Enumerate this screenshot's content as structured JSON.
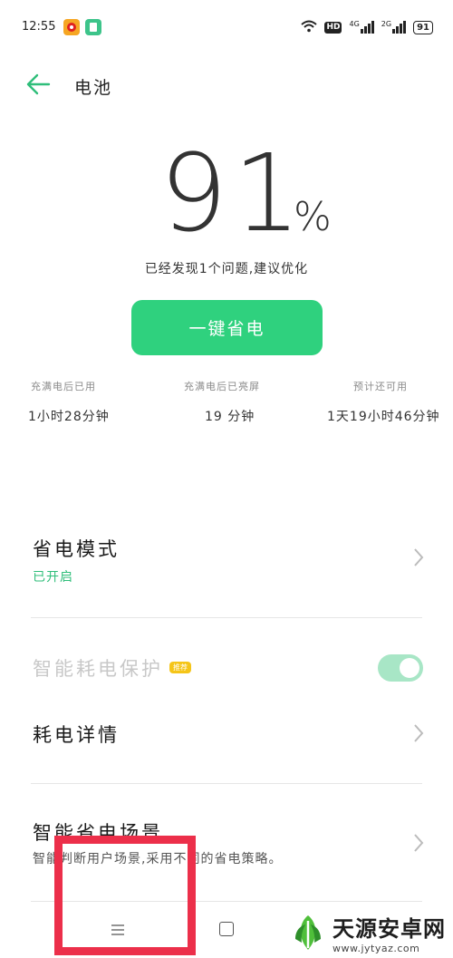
{
  "status_bar": {
    "time": "12:55",
    "network_4g": "4G",
    "network_2g": "2G",
    "hd_label": "HD",
    "battery_level": "91"
  },
  "header": {
    "title": "电池"
  },
  "battery": {
    "percent": "91",
    "percent_sign": "%",
    "hint": "已经发现1个问题,建议优化"
  },
  "save_button_label": "一键省电",
  "stats": [
    {
      "label": "充满电后已用",
      "value": "1小时28分钟"
    },
    {
      "label": "充满电后已亮屏",
      "value": "19 分钟"
    },
    {
      "label": "预计还可用",
      "value": "1天19小时46分钟"
    }
  ],
  "settings": {
    "power_saving_mode": {
      "title": "省电模式",
      "status": "已开启"
    },
    "smart_protection": {
      "title": "智能耗电保护",
      "tag": "推荐",
      "toggle_on": true
    },
    "power_details": {
      "title": "耗电详情"
    },
    "smart_scenes": {
      "title": "智能省电场景",
      "description": "智能判断用户场景,采用不同的省电策略。"
    }
  },
  "watermark": {
    "title": "天源安卓网",
    "url": "www.jytyaz.com"
  },
  "colors": {
    "accent": "#2fd17e",
    "highlight": "#ec2f4a"
  }
}
